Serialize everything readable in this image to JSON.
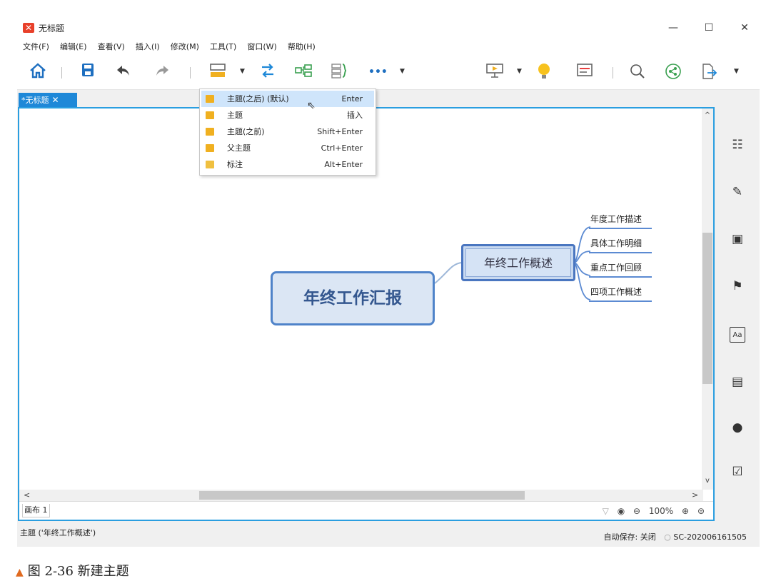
{
  "window": {
    "title": "无标题",
    "minimize": "—",
    "maximize": "☐",
    "close": "✕"
  },
  "menubar": [
    "文件(F)",
    "编辑(E)",
    "查看(V)",
    "插入(I)",
    "修改(M)",
    "工具(T)",
    "窗口(W)",
    "帮助(H)"
  ],
  "toolbar": {
    "icons": [
      "home-icon",
      "save-icon",
      "undo-icon",
      "redo-icon",
      "topic-icon",
      "relationship-icon",
      "summary-structure-icon",
      "boundary-icon",
      "more-icon",
      "presentation-icon",
      "idea-icon",
      "outliner-icon",
      "search-icon",
      "share-icon",
      "export-icon"
    ],
    "more": "•••"
  },
  "tab": {
    "label": "*无标题",
    "close": "✕"
  },
  "dropdown": {
    "items": [
      {
        "label": "主题(之后) (默认)",
        "shortcut": "Enter",
        "selected": true,
        "icon_color": "#f0b020"
      },
      {
        "label": "主题",
        "shortcut": "插入",
        "selected": false,
        "icon_color": "#f0b020"
      },
      {
        "label": "主题(之前)",
        "shortcut": "Shift+Enter",
        "selected": false,
        "icon_color": "#f0b020"
      },
      {
        "label": "父主题",
        "shortcut": "Ctrl+Enter",
        "selected": false,
        "icon_color": "#f0b020"
      },
      {
        "label": "标注",
        "shortcut": "Alt+Enter",
        "selected": false,
        "icon_color": "#f0b020"
      }
    ]
  },
  "mindmap": {
    "central": "年终工作汇报",
    "main_topic": "年终工作概述",
    "subtopics": [
      "年度工作描述",
      "具体工作明细",
      "重点工作回顾",
      "四项工作概述"
    ]
  },
  "canvas": {
    "sheet_tab": "画布 1",
    "zoom": "100%"
  },
  "rightpanel": {
    "icons": [
      "outline-icon",
      "format-brush-icon",
      "image-icon",
      "flag-icon",
      "text-style-icon",
      "notes-icon",
      "comment-icon",
      "task-icon"
    ]
  },
  "status": {
    "left": "主题 ('年终工作概述')",
    "autosave": "自动保存: 关闭",
    "device": "SC-202006161505"
  },
  "caption": "图 2-36   新建主题",
  "colors": {
    "accent": "#2a9ee0",
    "topic_border": "#4f83c9",
    "logo": "#e8402a"
  }
}
